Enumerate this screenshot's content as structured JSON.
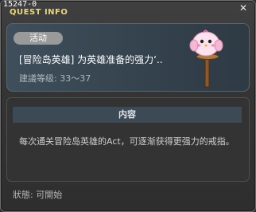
{
  "window": {
    "quest_id": "15247-0",
    "title": "QUEST INFO",
    "close_icon": "close-icon"
  },
  "quest": {
    "badge": "活动",
    "name": "[冒险岛英雄] 为英雄准备的强力‘..",
    "level": "建議等级: 33〜37",
    "mascot_icon": "pink-bird-signpost-icon"
  },
  "content": {
    "header": "内容",
    "description": "每次通关冒险岛英雄的Act，可逐渐获得更强力的戒指。"
  },
  "status": {
    "text": "狀態: 可開始"
  }
}
